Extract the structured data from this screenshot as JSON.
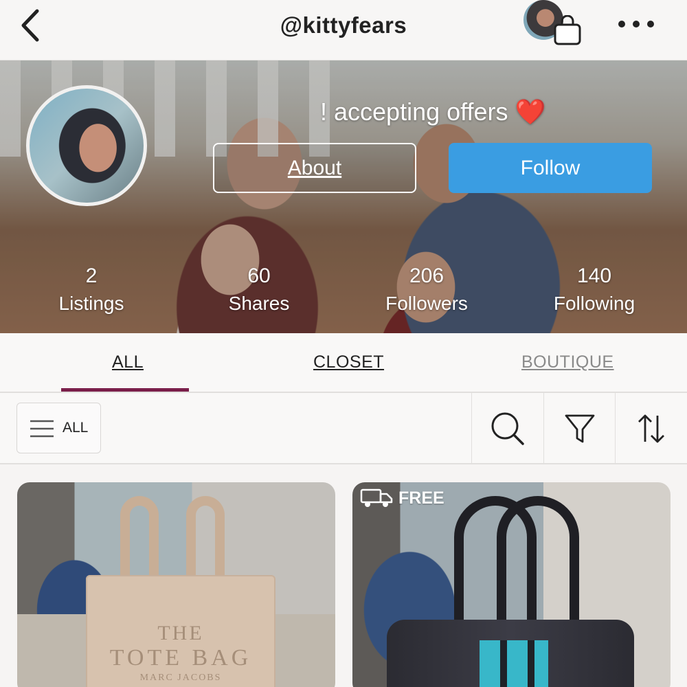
{
  "topbar": {
    "username": "@kittyfears"
  },
  "icons": {
    "back": "chevron-left-icon",
    "bag": "shopping-bag-icon",
    "more": "more-horizontal-icon",
    "search": "search-icon",
    "filter": "filter-funnel-icon",
    "sort": "sort-arrows-icon",
    "menu": "hamburger-icon",
    "shipping": "delivery-truck-icon"
  },
  "profile": {
    "bio": "! accepting offers ❤️",
    "about_label": "About",
    "follow_label": "Follow",
    "stats": [
      {
        "value": "2",
        "label": "Listings"
      },
      {
        "value": "60",
        "label": "Shares"
      },
      {
        "value": "206",
        "label": "Followers"
      },
      {
        "value": "140",
        "label": "Following"
      }
    ]
  },
  "tabs": [
    {
      "label": "ALL",
      "active": true
    },
    {
      "label": "CLOSET",
      "active": false
    },
    {
      "label": "BOUTIQUE",
      "active": false
    }
  ],
  "filter": {
    "all_label": "ALL"
  },
  "listings": [
    {
      "print": [
        "THE",
        "TOTE BAG",
        "MARC JACOBS"
      ]
    },
    {
      "badge": "FREE"
    }
  ],
  "colors": {
    "accent_follow": "#3a9de2",
    "tab_indicator": "#7a1f4a",
    "heart": "#e0201f"
  }
}
